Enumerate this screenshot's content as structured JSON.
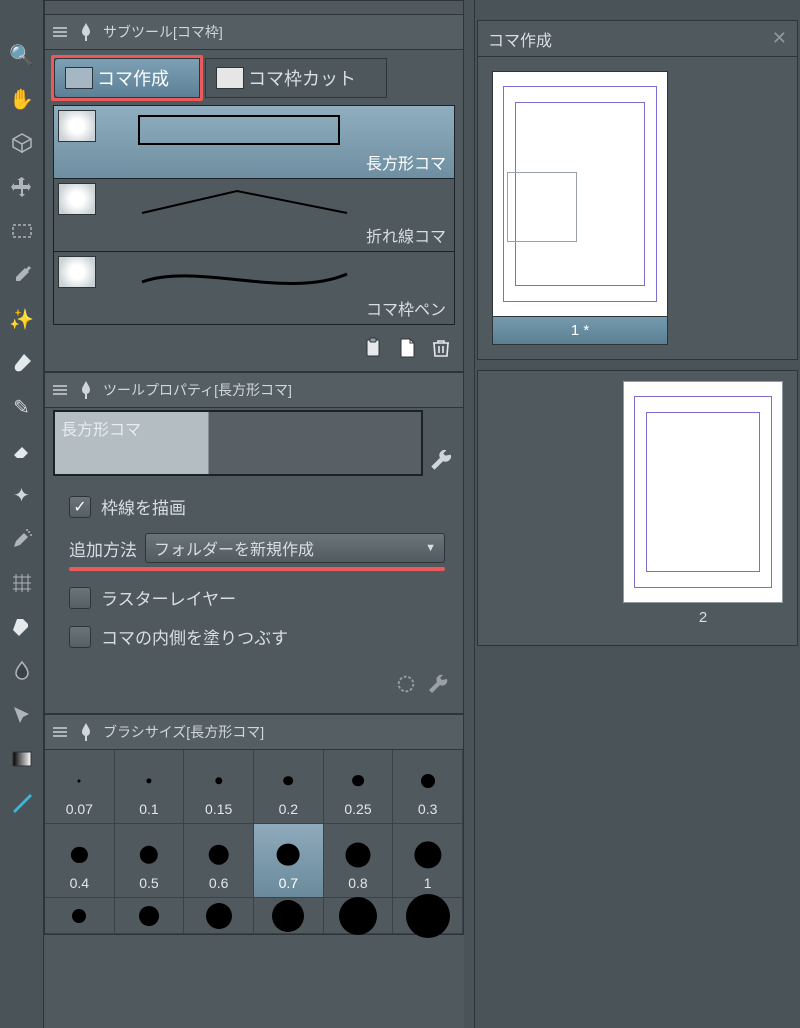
{
  "subtool_panel": {
    "title": "サブツール[コマ枠]",
    "tabs": {
      "create": "コマ作成",
      "cut": "コマ枠カット"
    },
    "items": [
      {
        "label": "長方形コマ",
        "selected": true,
        "shape": "rect"
      },
      {
        "label": "折れ線コマ",
        "selected": false,
        "shape": "poly"
      },
      {
        "label": "コマ枠ペン",
        "selected": false,
        "shape": "curve"
      }
    ]
  },
  "toolprop_panel": {
    "title": "ツールプロパティ[長方形コマ]",
    "preview_label": "長方形コマ",
    "draw_border": {
      "label": "枠線を描画",
      "checked": true
    },
    "add_method": {
      "label": "追加方法",
      "value": "フォルダーを新規作成"
    },
    "raster_layer": {
      "label": "ラスターレイヤー",
      "checked": false
    },
    "fill_inside": {
      "label": "コマの内側を塗りつぶす",
      "checked": false
    }
  },
  "brushsize_panel": {
    "title": "ブラシサイズ[長方形コマ]",
    "sizes": [
      0.07,
      0.1,
      0.15,
      0.2,
      0.25,
      0.3,
      0.4,
      0.5,
      0.6,
      0.7,
      0.8,
      1.0
    ],
    "selected": 0.7
  },
  "navigator_panel": {
    "title": "コマ作成",
    "pages": [
      {
        "caption": "1 *",
        "selected": true
      },
      {
        "caption": "2",
        "selected": false
      }
    ]
  },
  "tools_strip": [
    "zoom",
    "hand",
    "cube",
    "move",
    "marquee",
    "eyedropper",
    "wand",
    "brush",
    "pencil",
    "eraser",
    "sparkle",
    "airbrush",
    "mesh",
    "blend",
    "droplet",
    "select-path",
    "gradient-swatch",
    "ruler"
  ]
}
